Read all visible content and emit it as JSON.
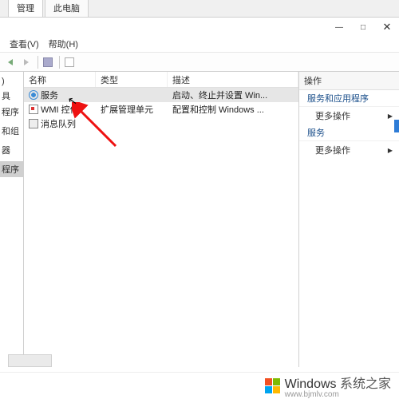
{
  "tabs": {
    "active": "管理",
    "inactive": "此电脑"
  },
  "menubar": {
    "view": "查看(V)",
    "help": "帮助(H)"
  },
  "win": {
    "min": "—",
    "max": "□",
    "close": "✕"
  },
  "tree": {
    "root": ")",
    "n1": "具",
    "n2": "程序",
    "n3": "",
    "n4": "和组",
    "n5": "",
    "n6": "器",
    "n7": "",
    "n8": "程序"
  },
  "columns": {
    "name": "名称",
    "type": "类型",
    "desc": "描述"
  },
  "rows": [
    {
      "name": "服务",
      "type": "",
      "desc": "启动、终止并设置 Win..."
    },
    {
      "name": "WMI 控件",
      "type": "扩展管理单元",
      "desc": "配置和控制 Windows ..."
    },
    {
      "name": "消息队列",
      "type": "",
      "desc": ""
    }
  ],
  "actions": {
    "title": "操作",
    "section1": "服务和应用程序",
    "item1": "更多操作",
    "section2": "服务",
    "item2": "更多操作"
  },
  "watermark": {
    "brand": "Windows",
    "tag": "系统之家",
    "url": "www.bjmlv.com"
  }
}
